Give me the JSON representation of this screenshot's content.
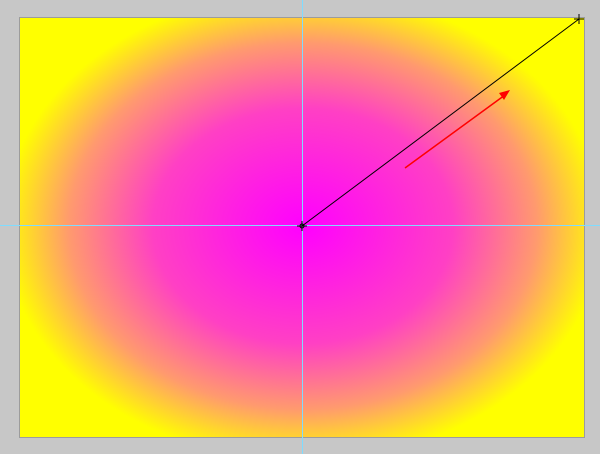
{
  "canvas": {
    "gradient": {
      "type": "radial",
      "center_color": "#ff00ff",
      "edge_color": "#ffff00"
    }
  },
  "guides": {
    "color": "#7fdcff",
    "vertical_count": 1,
    "horizontal_count": 1
  },
  "gradient_tool": {
    "drag_line_color": "#000000",
    "direction_arrow_color": "#ff0000",
    "start_marker_icon": "crosshair-icon",
    "end_marker_icon": "crosshair-icon",
    "arrow_icon": "arrow-icon"
  }
}
